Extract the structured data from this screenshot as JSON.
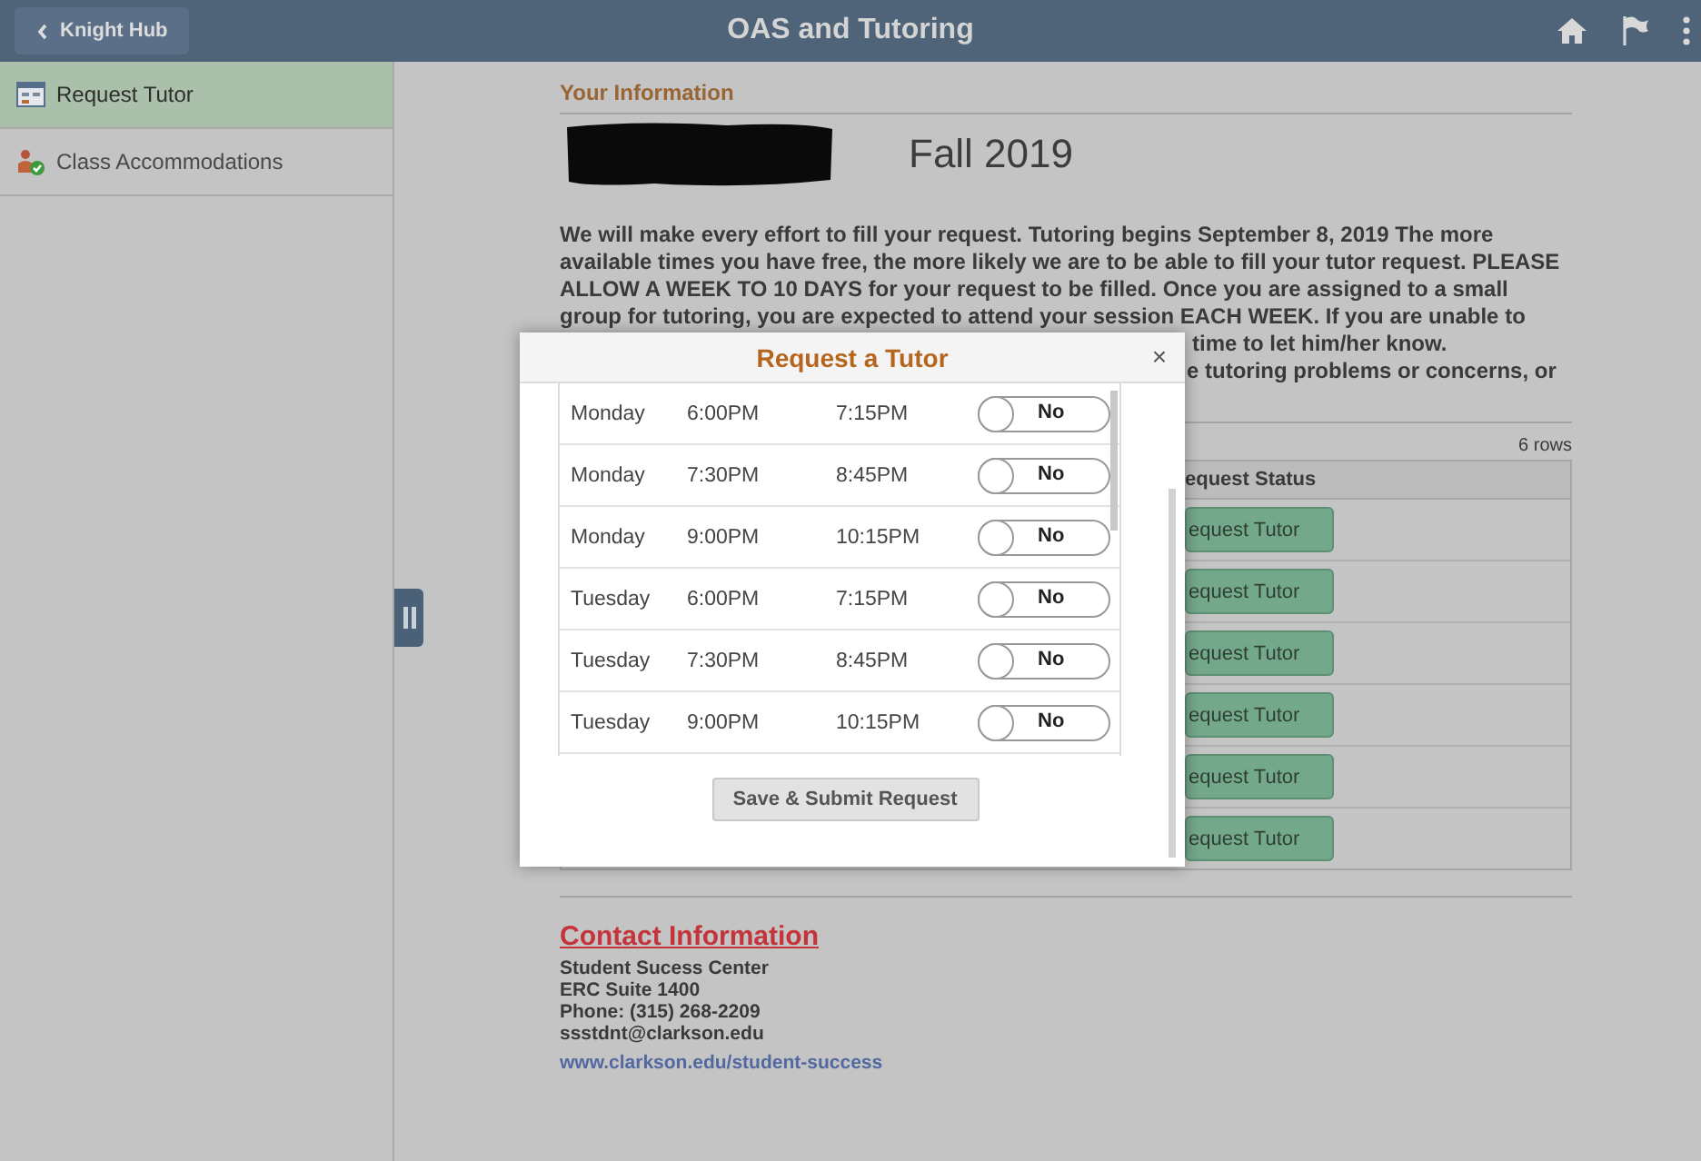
{
  "header": {
    "back_button": "Knight Hub",
    "title": "OAS and Tutoring"
  },
  "sidebar": {
    "items": [
      {
        "label": "Request Tutor",
        "selected": true
      },
      {
        "label": "Class Accommodations",
        "selected": false
      }
    ]
  },
  "content": {
    "section_title": "Your Information",
    "term": "Fall 2019",
    "intro_lines": [
      "We will make every effort to fill your request. Tutoring begins September 8, 2019 The more",
      "available times you have free, the more likely we are to be able to fill your tutor request. PLEASE",
      "ALLOW A WEEK TO 10 DAYS for your request to be filled. Once you are assigned to a small",
      "group for tutoring, you are expected to attend your session EACH WEEK. If you are unable to"
    ],
    "intro_fragments": [
      "time to let him/her know.",
      "e tutoring problems or concerns, or"
    ],
    "table": {
      "row_count": "6 rows",
      "status_header": "equest Status",
      "rows": [
        {
          "action": "equest Tutor"
        },
        {
          "action": "equest Tutor"
        },
        {
          "action": "equest Tutor"
        },
        {
          "action": "equest Tutor"
        },
        {
          "action": "equest Tutor"
        },
        {
          "action": "equest Tutor"
        }
      ]
    },
    "contact": {
      "heading": "Contact Information",
      "lines": [
        "Student Sucess Center",
        "ERC Suite 1400",
        "Phone: (315) 268-2209",
        "ssstdnt@clarkson.edu"
      ],
      "link": "www.clarkson.edu/student-success"
    }
  },
  "dialog": {
    "title": "Request a Tutor",
    "close": "×",
    "rows": [
      {
        "day": "Monday",
        "start": "6:00PM",
        "end": "7:15PM",
        "toggle": "No",
        "on": false
      },
      {
        "day": "Monday",
        "start": "7:30PM",
        "end": "8:45PM",
        "toggle": "No",
        "on": false
      },
      {
        "day": "Monday",
        "start": "9:00PM",
        "end": "10:15PM",
        "toggle": "No",
        "on": false
      },
      {
        "day": "Tuesday",
        "start": "6:00PM",
        "end": "7:15PM",
        "toggle": "No",
        "on": false
      },
      {
        "day": "Tuesday",
        "start": "7:30PM",
        "end": "8:45PM",
        "toggle": "No",
        "on": false
      },
      {
        "day": "Tuesday",
        "start": "9:00PM",
        "end": "10:15PM",
        "toggle": "No",
        "on": false
      }
    ],
    "submit_button": "Save & Submit Request"
  }
}
